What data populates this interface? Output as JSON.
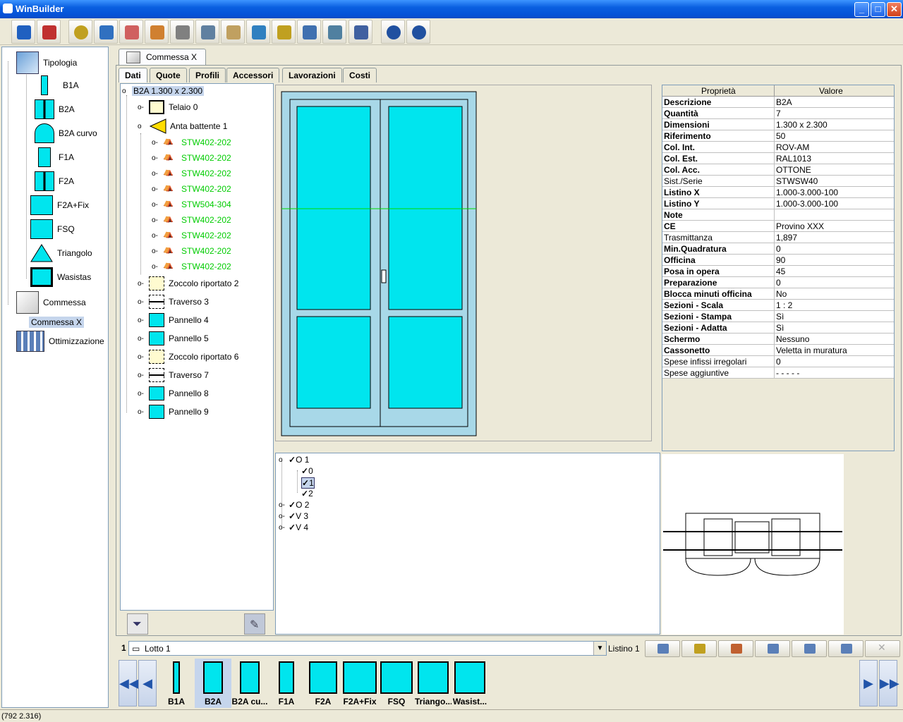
{
  "window": {
    "title": "WinBuilder",
    "minimize": "_",
    "maximize": "□",
    "close": "✕"
  },
  "toolbar": {
    "buttons": [
      "wb-logo-icon",
      "report-icon",
      "settings-gears-icon",
      "currency-exchange-icon",
      "document-transfer-icon",
      "chart-icon",
      "delete-icon",
      "print-icon",
      "clipboard-icon",
      "window-profile-icon",
      "key-icon",
      "stack-icon",
      "layers-icon",
      "optimize-icon",
      "zoom-in-icon",
      "zoom-out-icon"
    ]
  },
  "leftTree": {
    "tipologia": "Tipologia",
    "types": [
      "B1A",
      "B2A",
      "B2A curvo",
      "F1A",
      "F2A",
      "F2A+Fix",
      "FSQ",
      "Triangolo",
      "Wasistas"
    ],
    "commessa": "Commessa",
    "commessaX": "Commessa X",
    "ottimizzazione": "Ottimizzazione"
  },
  "docTab": {
    "label": "Commessa X"
  },
  "subtabs": [
    "Dati",
    "Quote",
    "Profili",
    "Accessori",
    "Lavorazioni",
    "Costi"
  ],
  "componentTree": {
    "root": "B2A 1.300 x 2.300",
    "telaio": "Telaio 0",
    "anta": "Anta battente 1",
    "profiles": [
      "STW402-202",
      "STW402-202",
      "STW402-202",
      "STW402-202",
      "STW504-304",
      "STW402-202",
      "STW402-202",
      "STW402-202",
      "STW402-202"
    ],
    "others": [
      "Zoccolo riportato 2",
      "Traverso 3",
      "Pannello 4",
      "Pannello 5",
      "Zoccolo riportato 6",
      "Traverso 7",
      "Pannello 8",
      "Pannello 9"
    ]
  },
  "properties": {
    "header": {
      "key": "Proprietà",
      "value": "Valore"
    },
    "rows": [
      {
        "k": "Descrizione",
        "v": "B2A",
        "b": true
      },
      {
        "k": "Quantità",
        "v": "7",
        "b": true
      },
      {
        "k": "Dimensioni",
        "v": "1.300 x 2.300",
        "b": true
      },
      {
        "k": "Riferimento",
        "v": "50",
        "b": true
      },
      {
        "k": "Col. Int.",
        "v": "ROV-AM",
        "b": true
      },
      {
        "k": "Col. Est.",
        "v": "RAL1013",
        "b": true
      },
      {
        "k": "Col. Acc.",
        "v": "OTTONE",
        "b": true
      },
      {
        "k": "Sist./Serie",
        "v": "STWSW40",
        "b": false
      },
      {
        "k": "Listino X",
        "v": "1.000-3.000-100",
        "b": true
      },
      {
        "k": "Listino Y",
        "v": "1.000-3.000-100",
        "b": true
      },
      {
        "k": "Note",
        "v": "",
        "b": true
      },
      {
        "k": "CE",
        "v": "Provino XXX",
        "b": true
      },
      {
        "k": "Trasmittanza",
        "v": "1,897",
        "b": false
      },
      {
        "k": "Min.Quadratura",
        "v": "0",
        "b": true
      },
      {
        "k": "Officina",
        "v": "90",
        "b": true
      },
      {
        "k": "Posa in opera",
        "v": "45",
        "b": true
      },
      {
        "k": "Preparazione",
        "v": "0",
        "b": true
      },
      {
        "k": "Blocca minuti officina",
        "v": "No",
        "b": true
      },
      {
        "k": "Sezioni - Scala",
        "v": "1 : 2",
        "b": true
      },
      {
        "k": "Sezioni - Stampa",
        "v": "Sì",
        "b": true
      },
      {
        "k": "Sezioni - Adatta",
        "v": "Sì",
        "b": true
      },
      {
        "k": "Schermo",
        "v": "Nessuno",
        "b": true
      },
      {
        "k": "Cassonetto",
        "v": "Veletta in muratura",
        "b": true
      },
      {
        "k": "Spese infissi irregolari",
        "v": "0",
        "b": false
      },
      {
        "k": "Spese aggiuntive",
        "v": "- - - - -",
        "b": false
      }
    ]
  },
  "sashTree": {
    "o1": "O 1",
    "c0": "0",
    "c1": "1",
    "c2": "2",
    "o2": "O 2",
    "v3": "V 3",
    "v4": "V 4"
  },
  "lotto": {
    "num": "1",
    "label": "Lotto 1",
    "listino": "Listino 1"
  },
  "gallery": [
    "B1A",
    "B2A",
    "B2A cu...",
    "F1A",
    "F2A",
    "F2A+Fix",
    "FSQ",
    "Triango...",
    "Wasist..."
  ],
  "nav": {
    "first": "◀◀",
    "prev": "◀",
    "next": "▶",
    "last": "▶▶"
  },
  "status": "(792 2.316)",
  "colors": {
    "glass": "#00e5ee",
    "frame": "#a8d8e8",
    "profileText": "#00cc00"
  }
}
